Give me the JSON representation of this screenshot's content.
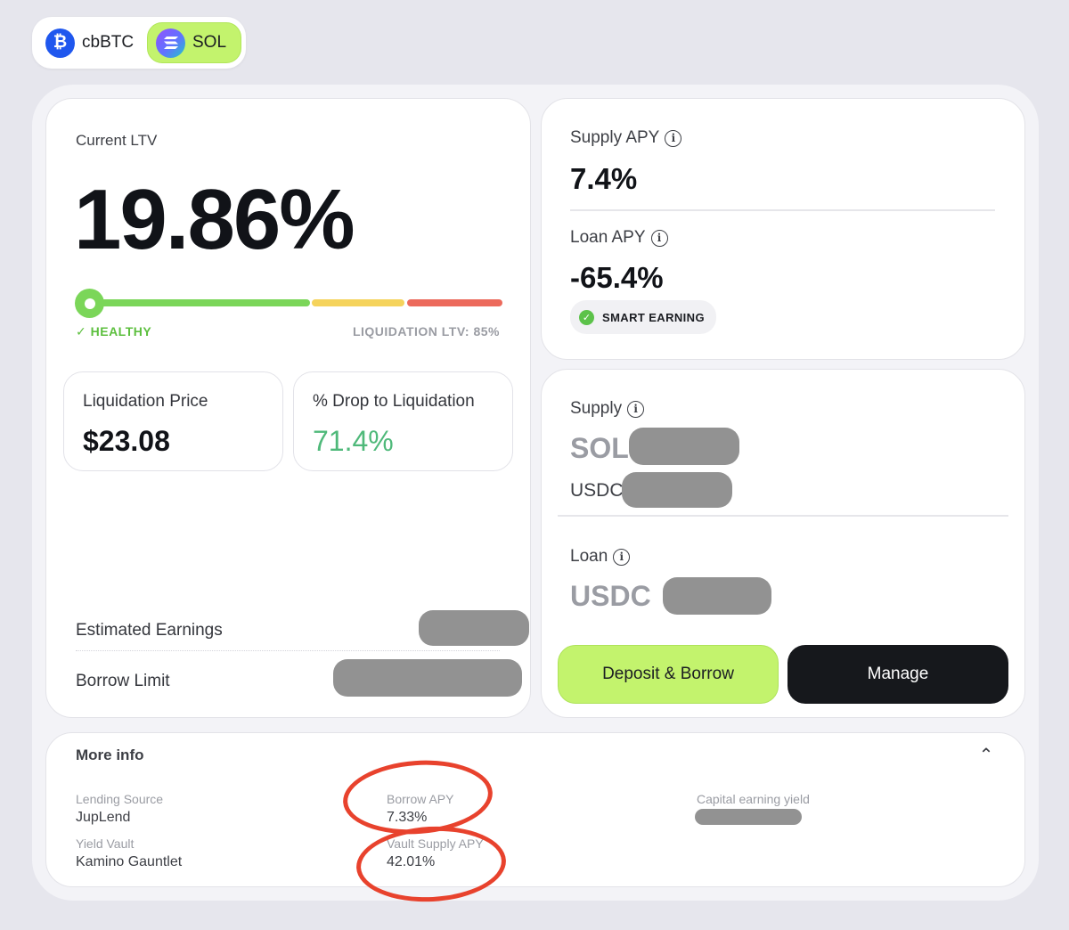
{
  "assets": {
    "items": [
      {
        "symbol": "cbBTC",
        "icon": "bitcoin-coin-icon",
        "selected": false
      },
      {
        "symbol": "SOL",
        "icon": "solana-coin-icon",
        "selected": true
      }
    ],
    "btc_glyph": "₿"
  },
  "ltv": {
    "label": "Current LTV",
    "value": "19.86%",
    "status": "✓  HEALTHY",
    "liquidation_ltv": "LIQUIDATION LTV: 85%"
  },
  "liquidation_price": {
    "label": "Liquidation Price",
    "value": "$23.08"
  },
  "drop_to_liquidation": {
    "label": "% Drop to Liquidation",
    "value": "71.4%"
  },
  "estimated_earnings": {
    "label": "Estimated Earnings"
  },
  "borrow_limit": {
    "label": "Borrow Limit"
  },
  "apy": {
    "supply_label": "Supply APY",
    "supply_value": "7.4%",
    "loan_label": "Loan APY",
    "loan_value": "-65.4%",
    "badge": "SMART EARNING"
  },
  "positions": {
    "supply_label": "Supply",
    "supply_assets": [
      "SOL",
      "USDC"
    ],
    "loan_label": "Loan",
    "loan_asset": "USDC"
  },
  "actions": {
    "deposit_borrow": "Deposit & Borrow",
    "manage": "Manage"
  },
  "more_info": {
    "title": "More info",
    "lending_source_label": "Lending Source",
    "lending_source_value": "JupLend",
    "yield_vault_label": "Yield Vault",
    "yield_vault_value": "Kamino Gauntlet",
    "borrow_apy_label": "Borrow APY",
    "borrow_apy_value": "7.33%",
    "vault_supply_apy_label": "Vault Supply APY",
    "vault_supply_apy_value": "42.01%",
    "capital_earning_yield_label": "Capital earning yield"
  },
  "info_glyph": "i",
  "collapse_glyph": "⌃",
  "colors": {
    "accent_green": "#c3f36d",
    "healthy": "#5cbf3e",
    "drop_value": "#4fb97a",
    "bar_green": "#7bd659",
    "bar_yellow": "#f5d35c",
    "bar_red": "#ec6a5c",
    "annotation_red": "#e8422d"
  }
}
